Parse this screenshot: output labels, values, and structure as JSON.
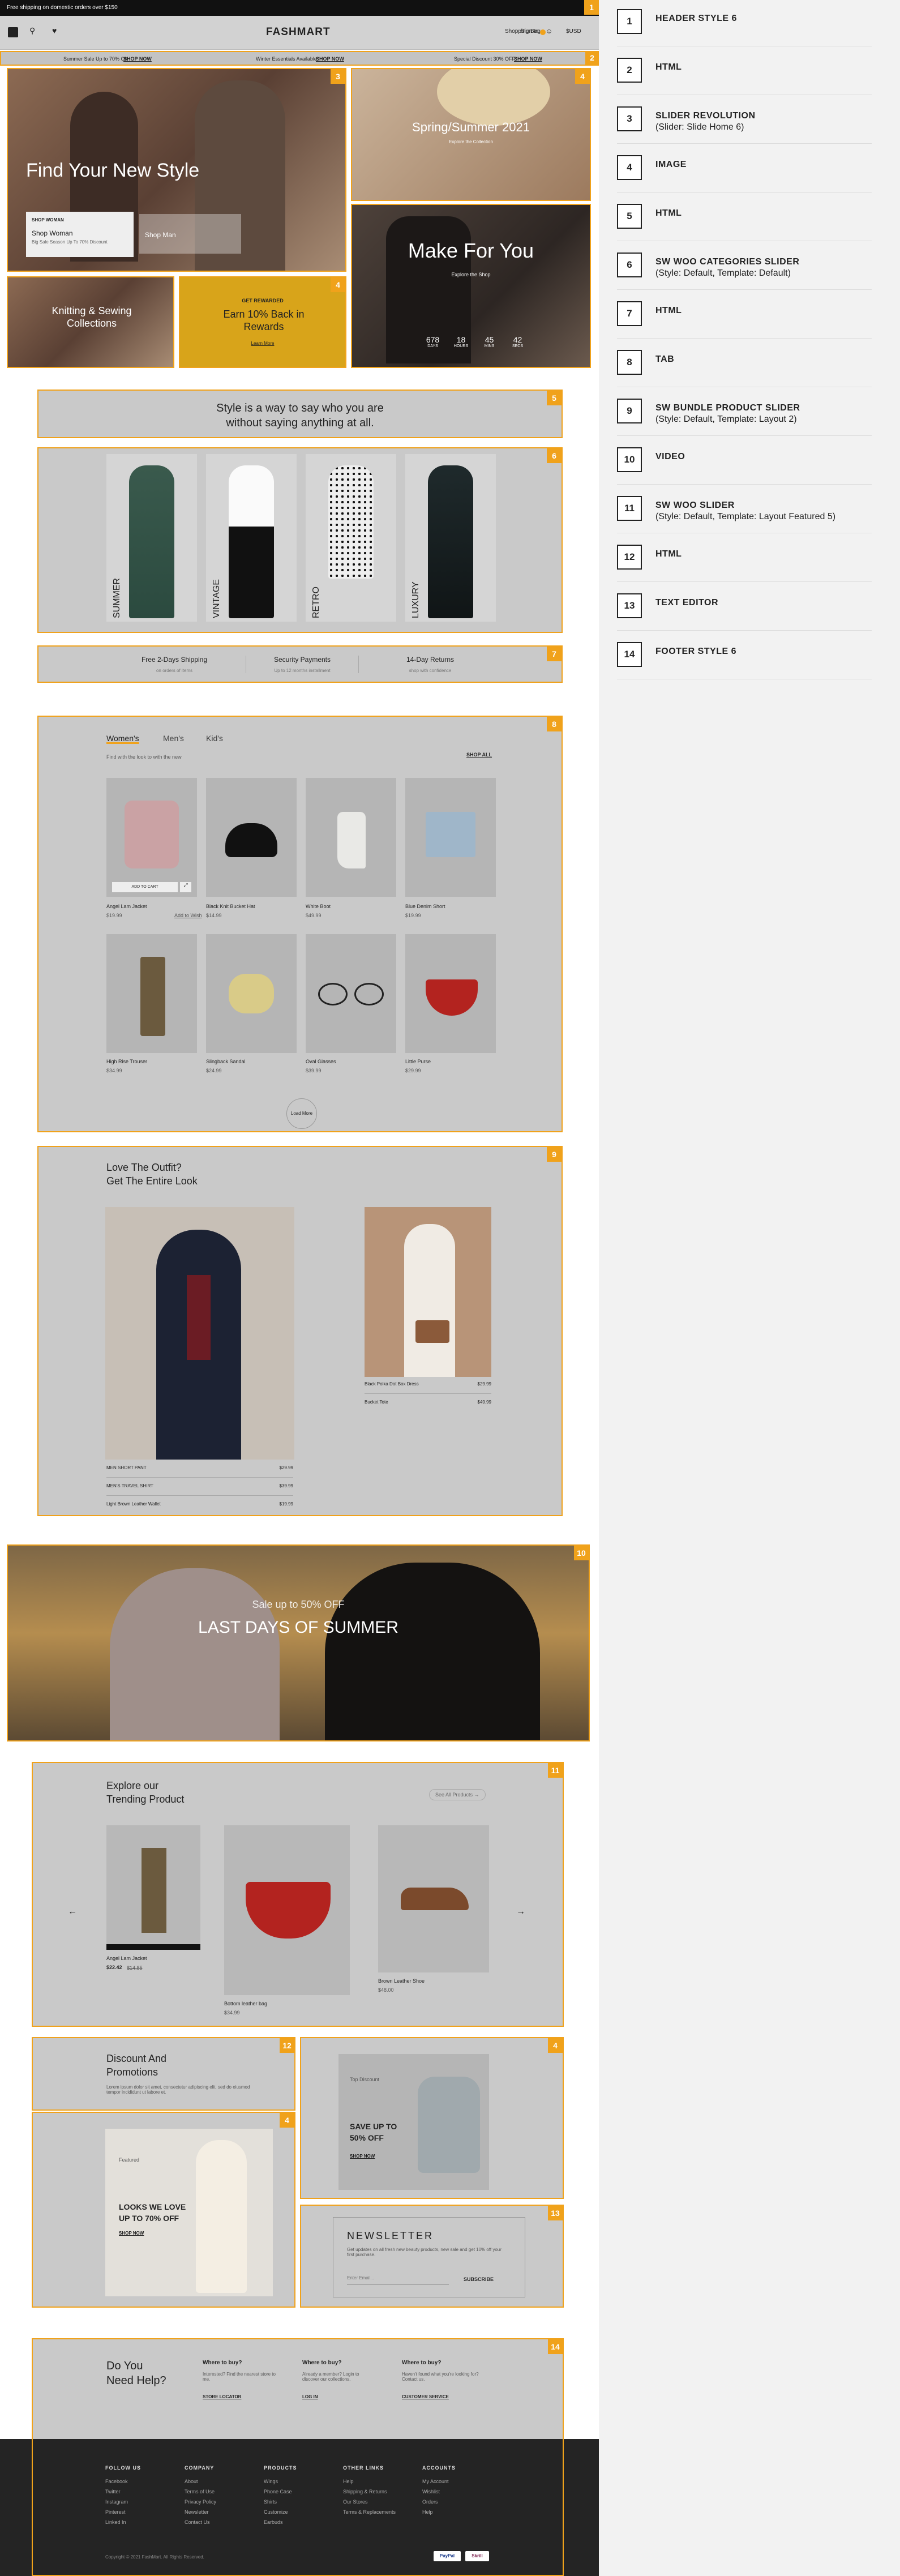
{
  "header": {
    "announcement": "Free shipping on domestic orders over $150",
    "logo": "FASHMART",
    "sign_in": "Sign In",
    "shopping_bag": "Shopping Bag",
    "currency": "$USD",
    "promo_left": "Summer Sale Up to 70% Off",
    "promo_left_link": "SHOP NOW",
    "promo_mid": "Winter Essentials Available",
    "promo_mid_link": "SHOP NOW",
    "promo_right": "Special Discount 30% OFF",
    "promo_right_link": "SHOP NOW"
  },
  "slider": {
    "headline": "Find Your New Style",
    "card_label": "SHOP WOMAN",
    "card_title": "Shop Woman",
    "card_desc": "Big Sale Season Up To 70% Discount",
    "card2_title": "Shop Man",
    "img_tr_title": "Spring/Summer 2021",
    "img_tr_link": "Explore the Collection",
    "img_br_title": "Make For You",
    "img_br_sub": "Explore the Shop",
    "countdown": [
      {
        "num": "678",
        "label": "DAYS"
      },
      {
        "num": "18",
        "label": "HOURS"
      },
      {
        "num": "45",
        "label": "MINS"
      },
      {
        "num": "42",
        "label": "SECS"
      }
    ],
    "knit_title": "Knitting & Sewing Collections",
    "reward_small": "GET REWARDED",
    "reward_title": "Earn 10% Back in Rewards",
    "reward_link": "Learn More"
  },
  "quote": {
    "line1": "Style is a way to say who you are",
    "line2": "without saying anything at all."
  },
  "categories": [
    "SUMMER",
    "VINTAGE",
    "RETRO",
    "LUXURY"
  ],
  "features": [
    {
      "title": "Free 2-Days Shipping",
      "sub": "on orders of items"
    },
    {
      "title": "Security Payments",
      "sub": "Up to 12 months installment"
    },
    {
      "title": "14-Day Returns",
      "sub": "shop with confidence"
    }
  ],
  "tabs": {
    "items": [
      "Women's",
      "Men's",
      "Kid's"
    ],
    "subtitle": "Find with the look to with the new",
    "shop_all": "SHOP ALL",
    "add_to_cart": "ADD TO CART",
    "products": [
      {
        "name": "Angel Lam Jacket",
        "price": "$19.99",
        "extra": "Add to Wish"
      },
      {
        "name": "Black Knit Bucket Hat",
        "price": "$14.99",
        "extra": ""
      },
      {
        "name": "White Boot",
        "price": "$49.99",
        "extra": ""
      },
      {
        "name": "Blue Denim Short",
        "price": "$19.99",
        "extra": ""
      },
      {
        "name": "High Rise Trouser",
        "price": "$34.99",
        "extra": ""
      },
      {
        "name": "Slingback Sandal",
        "price": "$24.99",
        "extra": ""
      },
      {
        "name": "Oval Glasses",
        "price": "$39.99",
        "extra": ""
      },
      {
        "name": "Little Purse",
        "price": "$29.99",
        "extra": ""
      }
    ],
    "load_more": "Load More"
  },
  "bundle": {
    "title_line1": "Love The Outfit?",
    "title_line2": "Get The Entire Look",
    "left_items": [
      {
        "name": "MEN SHORT PANT",
        "price": "$29.99"
      },
      {
        "name": "MEN'S TRAVEL SHIRT",
        "price": "$39.99"
      },
      {
        "name": "Light Brown Leather Wallet",
        "price": "$19.99"
      }
    ],
    "right_items": [
      {
        "name": "Black Polka Dot Box Dress",
        "price": "$29.99"
      },
      {
        "name": "Bucket Tote",
        "price": "$49.99"
      }
    ]
  },
  "video": {
    "small": "Sale up to 50% OFF",
    "title": "LAST DAYS OF SUMMER"
  },
  "trending": {
    "title_line1": "Explore our",
    "title_line2": "Trending Product",
    "see_all": "See All Products →",
    "prev": "←",
    "next": "→",
    "items": [
      {
        "name": "Angel Lam Jacket",
        "price": "$22.42",
        "old": "$14.85"
      },
      {
        "name": "Bottom leather bag",
        "price": "$34.99",
        "old": ""
      },
      {
        "name": "Brown Leather Shoe",
        "price": "$48.00",
        "old": ""
      }
    ]
  },
  "promos": {
    "discount_title1": "Discount And",
    "discount_title2": "Promotions",
    "discount_desc": "Lorem ipsum dolor sit amet, consectetur adipiscing elit, sed do eiusmod tempor incididunt ut labore et.",
    "left_small": "Featured",
    "left_title1": "LOOKS WE LOVE",
    "left_title2": "UP TO 70% OFF",
    "left_link": "SHOP NOW",
    "right_small": "Top Discount",
    "right_title1": "SAVE UP TO",
    "right_title2": "50% OFF",
    "right_link": "SHOP NOW"
  },
  "newsletter": {
    "title": "NEWSLETTER",
    "desc": "Get updates on all fresh new beauty products, new sale and get 10% off your first purchase.",
    "placeholder": "Enter Email...",
    "button": "SUBSCRIBE"
  },
  "footer": {
    "help_title1": "Do You",
    "help_title2": "Need Help?",
    "help_cols": [
      {
        "title": "Where to buy?",
        "text": "Interested? Find the nearest store to me.",
        "link": "STORE LOCATOR"
      },
      {
        "title": "Where to buy?",
        "text": "Already a member? Login to discover our collections.",
        "link": "LOG IN"
      },
      {
        "title": "Where to buy?",
        "text": "Haven't found what you're looking for? Contact us.",
        "link": "CUSTOMER SERVICE"
      }
    ],
    "link_cols": [
      {
        "title": "FOLLOW US",
        "items": [
          "Facebook",
          "Twitter",
          "Instagram",
          "Pinterest",
          "Linked In"
        ]
      },
      {
        "title": "COMPANY",
        "items": [
          "About",
          "Terms of Use",
          "Privacy Policy",
          "Newsletter",
          "Contact Us"
        ]
      },
      {
        "title": "PRODUCTS",
        "items": [
          "Wings",
          "Phone Case",
          "Shirts",
          "Customize",
          "Earbuds"
        ]
      },
      {
        "title": "OTHER LINKS",
        "items": [
          "Help",
          "Shipping & Returns",
          "Our Stores",
          "Terms & Replacements"
        ]
      },
      {
        "title": "ACCOUNTS",
        "items": [
          "My Account",
          "Wishlist",
          "Orders",
          "Help"
        ]
      }
    ],
    "copyright": "Copyright © 2021 FashMart. All Rights Reserved.",
    "pay1": "PayPal",
    "pay2": "Skrill"
  },
  "legend": [
    {
      "num": "1",
      "title": "HEADER STYLE 6",
      "sub": ""
    },
    {
      "num": "2",
      "title": "HTML",
      "sub": ""
    },
    {
      "num": "3",
      "title": "SLIDER REVOLUTION",
      "sub": "(Slider: Slide Home 6)"
    },
    {
      "num": "4",
      "title": "IMAGE",
      "sub": ""
    },
    {
      "num": "5",
      "title": "HTML",
      "sub": ""
    },
    {
      "num": "6",
      "title": "SW WOO CATEGORIES SLIDER",
      "sub": "(Style: Default,  Template: Default)"
    },
    {
      "num": "7",
      "title": "HTML",
      "sub": ""
    },
    {
      "num": "8",
      "title": "TAB",
      "sub": ""
    },
    {
      "num": "9",
      "title": " SW BUNDLE PRODUCT SLIDER",
      "sub": "(Style: Default, Template: Layout 2)"
    },
    {
      "num": "10",
      "title": "VIDEO",
      "sub": ""
    },
    {
      "num": "11",
      "title": "SW WOO SLIDER",
      "sub": "(Style: Default, Template: Layout Featured 5)"
    },
    {
      "num": "12",
      "title": "HTML",
      "sub": ""
    },
    {
      "num": "13",
      "title": "TEXT EDITOR",
      "sub": ""
    },
    {
      "num": "14",
      "title": "FOOTER STYLE 6",
      "sub": ""
    }
  ],
  "badges": {
    "b1": "1",
    "b2": "2",
    "b3": "3",
    "b4": "4",
    "b5": "5",
    "b6": "6",
    "b7": "7",
    "b8": "8",
    "b9": "9",
    "b10": "10",
    "b11": "11",
    "b12": "12",
    "b13": "13",
    "b14": "14"
  }
}
